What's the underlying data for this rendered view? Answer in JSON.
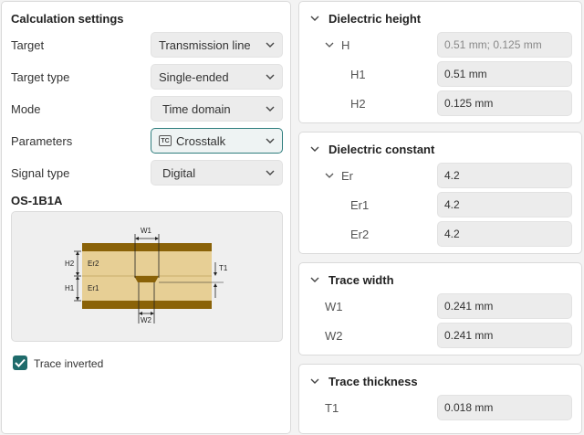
{
  "calc": {
    "title": "Calculation settings",
    "rows": [
      {
        "label": "Target",
        "value": "Transmission line"
      },
      {
        "label": "Target type",
        "value": "Single-ended"
      },
      {
        "label": "Mode",
        "value": "Time domain"
      },
      {
        "label": "Parameters",
        "value": "Crosstalk",
        "badge": "TC"
      },
      {
        "label": "Signal type",
        "value": "Digital"
      }
    ]
  },
  "structure": {
    "title": "OS-1B1A",
    "labels": {
      "w1": "W1",
      "w2": "W2",
      "h1": "H1",
      "h2": "H2",
      "er1": "Er1",
      "er2": "Er2",
      "t1": "T1"
    }
  },
  "trace_inverted": {
    "label": "Trace inverted",
    "checked": true
  },
  "dielectric_height": {
    "title": "Dielectric height",
    "parent_label": "H",
    "parent_value": "0.51 mm; 0.125 mm",
    "children": [
      {
        "label": "H1",
        "value": "0.51 mm"
      },
      {
        "label": "H2",
        "value": "0.125 mm"
      }
    ]
  },
  "dielectric_constant": {
    "title": "Dielectric constant",
    "parent_label": "Er",
    "parent_value": "4.2",
    "children": [
      {
        "label": "Er1",
        "value": "4.2"
      },
      {
        "label": "Er2",
        "value": "4.2"
      }
    ]
  },
  "trace_width": {
    "title": "Trace width",
    "rows": [
      {
        "label": "W1",
        "value": "0.241 mm"
      },
      {
        "label": "W2",
        "value": "0.241 mm"
      }
    ]
  },
  "trace_thickness": {
    "title": "Trace thickness",
    "rows": [
      {
        "label": "T1",
        "value": "0.018 mm"
      }
    ]
  },
  "colors": {
    "accent": "#1f6b6b",
    "copper": "#8a6208",
    "dielectric": "#e7cf95"
  }
}
